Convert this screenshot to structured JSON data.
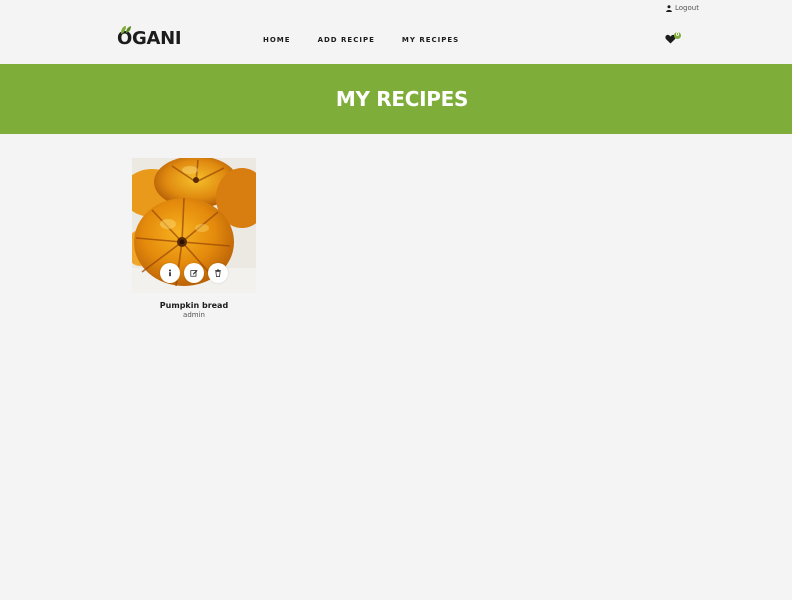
{
  "header": {
    "logout_label": "Logout",
    "logo_text": "OGANI",
    "nav": [
      {
        "label": "HOME"
      },
      {
        "label": "ADD RECIPE"
      },
      {
        "label": "MY RECIPES"
      }
    ],
    "favorites_count": "0"
  },
  "banner": {
    "title": "MY RECIPES"
  },
  "recipes": [
    {
      "title": "Pumpkin bread",
      "author": "admin"
    }
  ],
  "colors": {
    "accent": "#7fad39",
    "background": "#f4f4f4",
    "text": "#1c1c1c"
  },
  "icons": {
    "logout": "user-icon",
    "favorites": "heart-icon",
    "info": "info-icon",
    "edit": "edit-icon",
    "delete": "trash-icon"
  }
}
